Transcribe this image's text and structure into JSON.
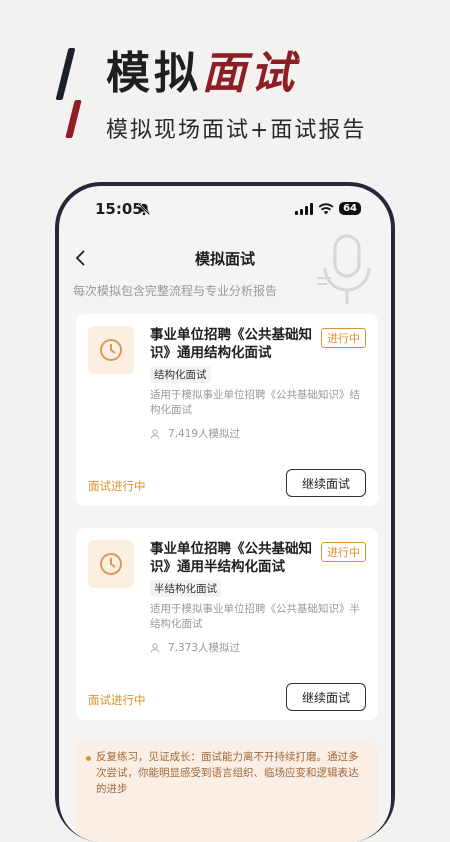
{
  "banner": {
    "title_main": "模拟",
    "title_accent": "面试",
    "subtitle": "模拟现场面试+面试报告"
  },
  "status_bar": {
    "time": "15:05",
    "battery": "64"
  },
  "nav": {
    "title": "模拟面试"
  },
  "page": {
    "subtitle": "每次模拟包含完整流程与专业分析报告"
  },
  "cards": [
    {
      "title": "事业单位招聘《公共基础知识》通用结构化面试",
      "badge": "进行中",
      "tag": "结构化面试",
      "description": "适用于模拟事业单位招聘《公共基础知识》结构化面试",
      "count": "7,419人模拟过",
      "status": "面试进行中",
      "button": "继续面试"
    },
    {
      "title": "事业单位招聘《公共基础知识》通用半结构化面试",
      "badge": "进行中",
      "tag": "半结构化面试",
      "description": "适用于模拟事业单位招聘《公共基础知识》半结构化面试",
      "count": "7,373人模拟过",
      "status": "面试进行中",
      "button": "继续面试"
    }
  ],
  "tip": {
    "heading": "反复练习，见证成长：",
    "text": "面试能力离不开持续打磨。通过多次尝试，你能明显感受到语言组织、临场应变和逻辑表达的进步"
  },
  "colors": {
    "accent_red": "#8e1e24",
    "accent_orange": "#e0902e",
    "phone_frame": "#26283a"
  },
  "icons": [
    "bell-off-icon",
    "signal-icon",
    "wifi-icon",
    "battery-icon",
    "back-icon",
    "microphone-icon",
    "clock-icon",
    "user-icon"
  ]
}
